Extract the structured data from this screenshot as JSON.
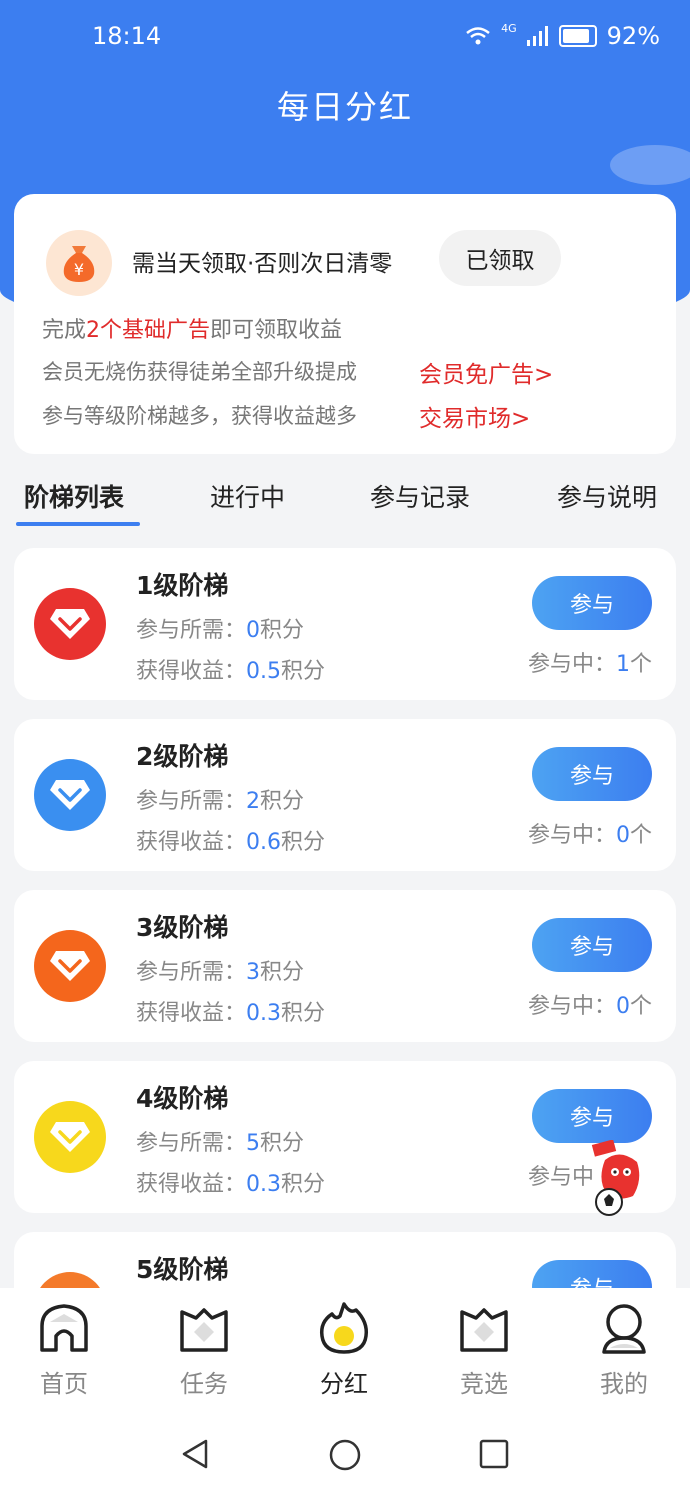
{
  "status": {
    "time": "18:14",
    "network": "4G",
    "battery": "92%"
  },
  "page": {
    "title": "每日分红"
  },
  "notice": {
    "title": "需当天领取·否则次日清零",
    "claim_button": "已领取",
    "line1_prefix": "完成",
    "line1_highlight": "2个基础广告",
    "line1_suffix": "即可领取收益",
    "line2_text": "会员无烧伤获得徒弟全部升级提成",
    "line2_link": "会员免广告>",
    "line3_text": "参与等级阶梯越多，获得收益越多",
    "line3_link": "交易市场>"
  },
  "tabs": [
    "阶梯列表",
    "进行中",
    "参与记录",
    "参与说明"
  ],
  "tiers": [
    {
      "name": "1级阶梯",
      "req_label": "参与所需：",
      "req_value": "0",
      "req_unit": "积分",
      "reward_label": "获得收益：",
      "reward_value": "0.5",
      "reward_unit": "积分",
      "join_label": "参与",
      "count_label": "参与中：",
      "count_value": "1",
      "count_unit": "个",
      "color": "#e8322f"
    },
    {
      "name": "2级阶梯",
      "req_label": "参与所需：",
      "req_value": "2",
      "req_unit": "积分",
      "reward_label": "获得收益：",
      "reward_value": "0.6",
      "reward_unit": "积分",
      "join_label": "参与",
      "count_label": "参与中：",
      "count_value": "0",
      "count_unit": "个",
      "color": "#3a8ff0"
    },
    {
      "name": "3级阶梯",
      "req_label": "参与所需：",
      "req_value": "3",
      "req_unit": "积分",
      "reward_label": "获得收益：",
      "reward_value": "0.3",
      "reward_unit": "积分",
      "join_label": "参与",
      "count_label": "参与中：",
      "count_value": "0",
      "count_unit": "个",
      "color": "#f4661c"
    },
    {
      "name": "4级阶梯",
      "req_label": "参与所需：",
      "req_value": "5",
      "req_unit": "积分",
      "reward_label": "获得收益：",
      "reward_value": "0.3",
      "reward_unit": "积分",
      "join_label": "参与",
      "count_label": "参与中",
      "count_value": "",
      "count_unit": "",
      "color": "#f7d81c"
    },
    {
      "name": "5级阶梯",
      "join_label": "参与",
      "color": "#f47a2a"
    }
  ],
  "bottom_nav": [
    {
      "label": "首页",
      "icon": "home-icon"
    },
    {
      "label": "任务",
      "icon": "task-icon"
    },
    {
      "label": "分红",
      "icon": "dividend-flame-icon"
    },
    {
      "label": "竞选",
      "icon": "election-icon"
    },
    {
      "label": "我的",
      "icon": "profile-icon"
    }
  ],
  "colors": {
    "primary": "#3c7ef0",
    "highlight": "#e02b2b"
  }
}
